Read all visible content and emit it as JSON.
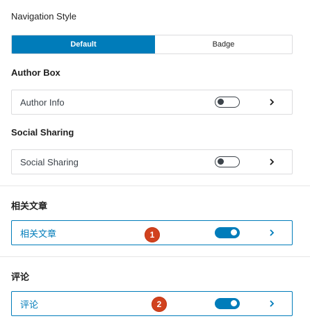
{
  "navigation_style": {
    "label": "Navigation Style",
    "options": [
      {
        "label": "Default",
        "selected": true
      },
      {
        "label": "Badge",
        "selected": false
      }
    ]
  },
  "sections": [
    {
      "title": "Author Box",
      "row_label": "Author Info",
      "toggle_on": false,
      "active": false
    },
    {
      "title": "Social Sharing",
      "row_label": "Social Sharing",
      "toggle_on": false,
      "active": false
    },
    {
      "title": "相关文章",
      "row_label": "相关文章",
      "toggle_on": true,
      "active": true,
      "annotation": "1"
    },
    {
      "title": "评论",
      "row_label": "评论",
      "toggle_on": true,
      "active": true,
      "annotation": "2"
    }
  ],
  "colors": {
    "accent": "#007cba",
    "toggle_off": "#3c434a",
    "annotation_badge": "#d1421e",
    "border": "#dcdcde"
  },
  "icons": {
    "row_action": "chevron-right-icon",
    "toggle": "toggle-switch"
  }
}
